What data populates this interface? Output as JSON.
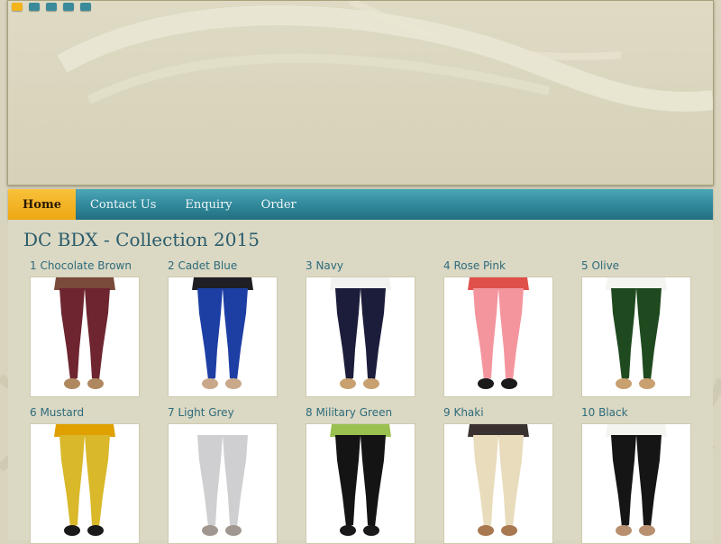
{
  "banner": {
    "slides": [
      {
        "name": "slide-1",
        "active": true
      },
      {
        "name": "slide-2",
        "active": false
      },
      {
        "name": "slide-3",
        "active": false
      },
      {
        "name": "slide-4",
        "active": false
      },
      {
        "name": "slide-5",
        "active": false
      }
    ]
  },
  "nav": {
    "items": [
      {
        "label": "Home",
        "active": true
      },
      {
        "label": "Contact Us",
        "active": false
      },
      {
        "label": "Enquiry",
        "active": false
      },
      {
        "label": "Order",
        "active": false
      }
    ]
  },
  "page": {
    "title": "DC BDX - Collection 2015"
  },
  "products": [
    {
      "label": "1 Chocolate Brown",
      "color": "#6e2530",
      "top": "#7a4a3a",
      "shoes": "#b08860"
    },
    {
      "label": "2 Cadet Blue",
      "color": "#1d3fa4",
      "top": "#1e1e24",
      "shoes": "#c9a98a"
    },
    {
      "label": "3  Navy",
      "color": "#1c1d3a",
      "top": "#f2f2f0",
      "shoes": "#c9a070"
    },
    {
      "label": "4 Rose Pink",
      "color": "#f4959e",
      "top": "#e0504a",
      "shoes": "#1a1a1a"
    },
    {
      "label": "5 Olive",
      "color": "#1f4a1f",
      "top": "#f4f4f0",
      "shoes": "#c9a070"
    },
    {
      "label": "6 Mustard",
      "color": "#d9b82a",
      "top": "#e0a000",
      "shoes": "#1a1a1a"
    },
    {
      "label": "7 Light Grey",
      "color": "#cfcfd2",
      "top": "#ffffff",
      "shoes": "#a09890"
    },
    {
      "label": "8 Military Green",
      "color": "#141414",
      "top": "#9ac050",
      "shoes": "#1a1a1a"
    },
    {
      "label": "9 Khaki",
      "color": "#e8dcbc",
      "top": "#3a3230",
      "shoes": "#a87850"
    },
    {
      "label": "10 Black",
      "color": "#151515",
      "top": "#f4f4f0",
      "shoes": "#b89070"
    }
  ]
}
